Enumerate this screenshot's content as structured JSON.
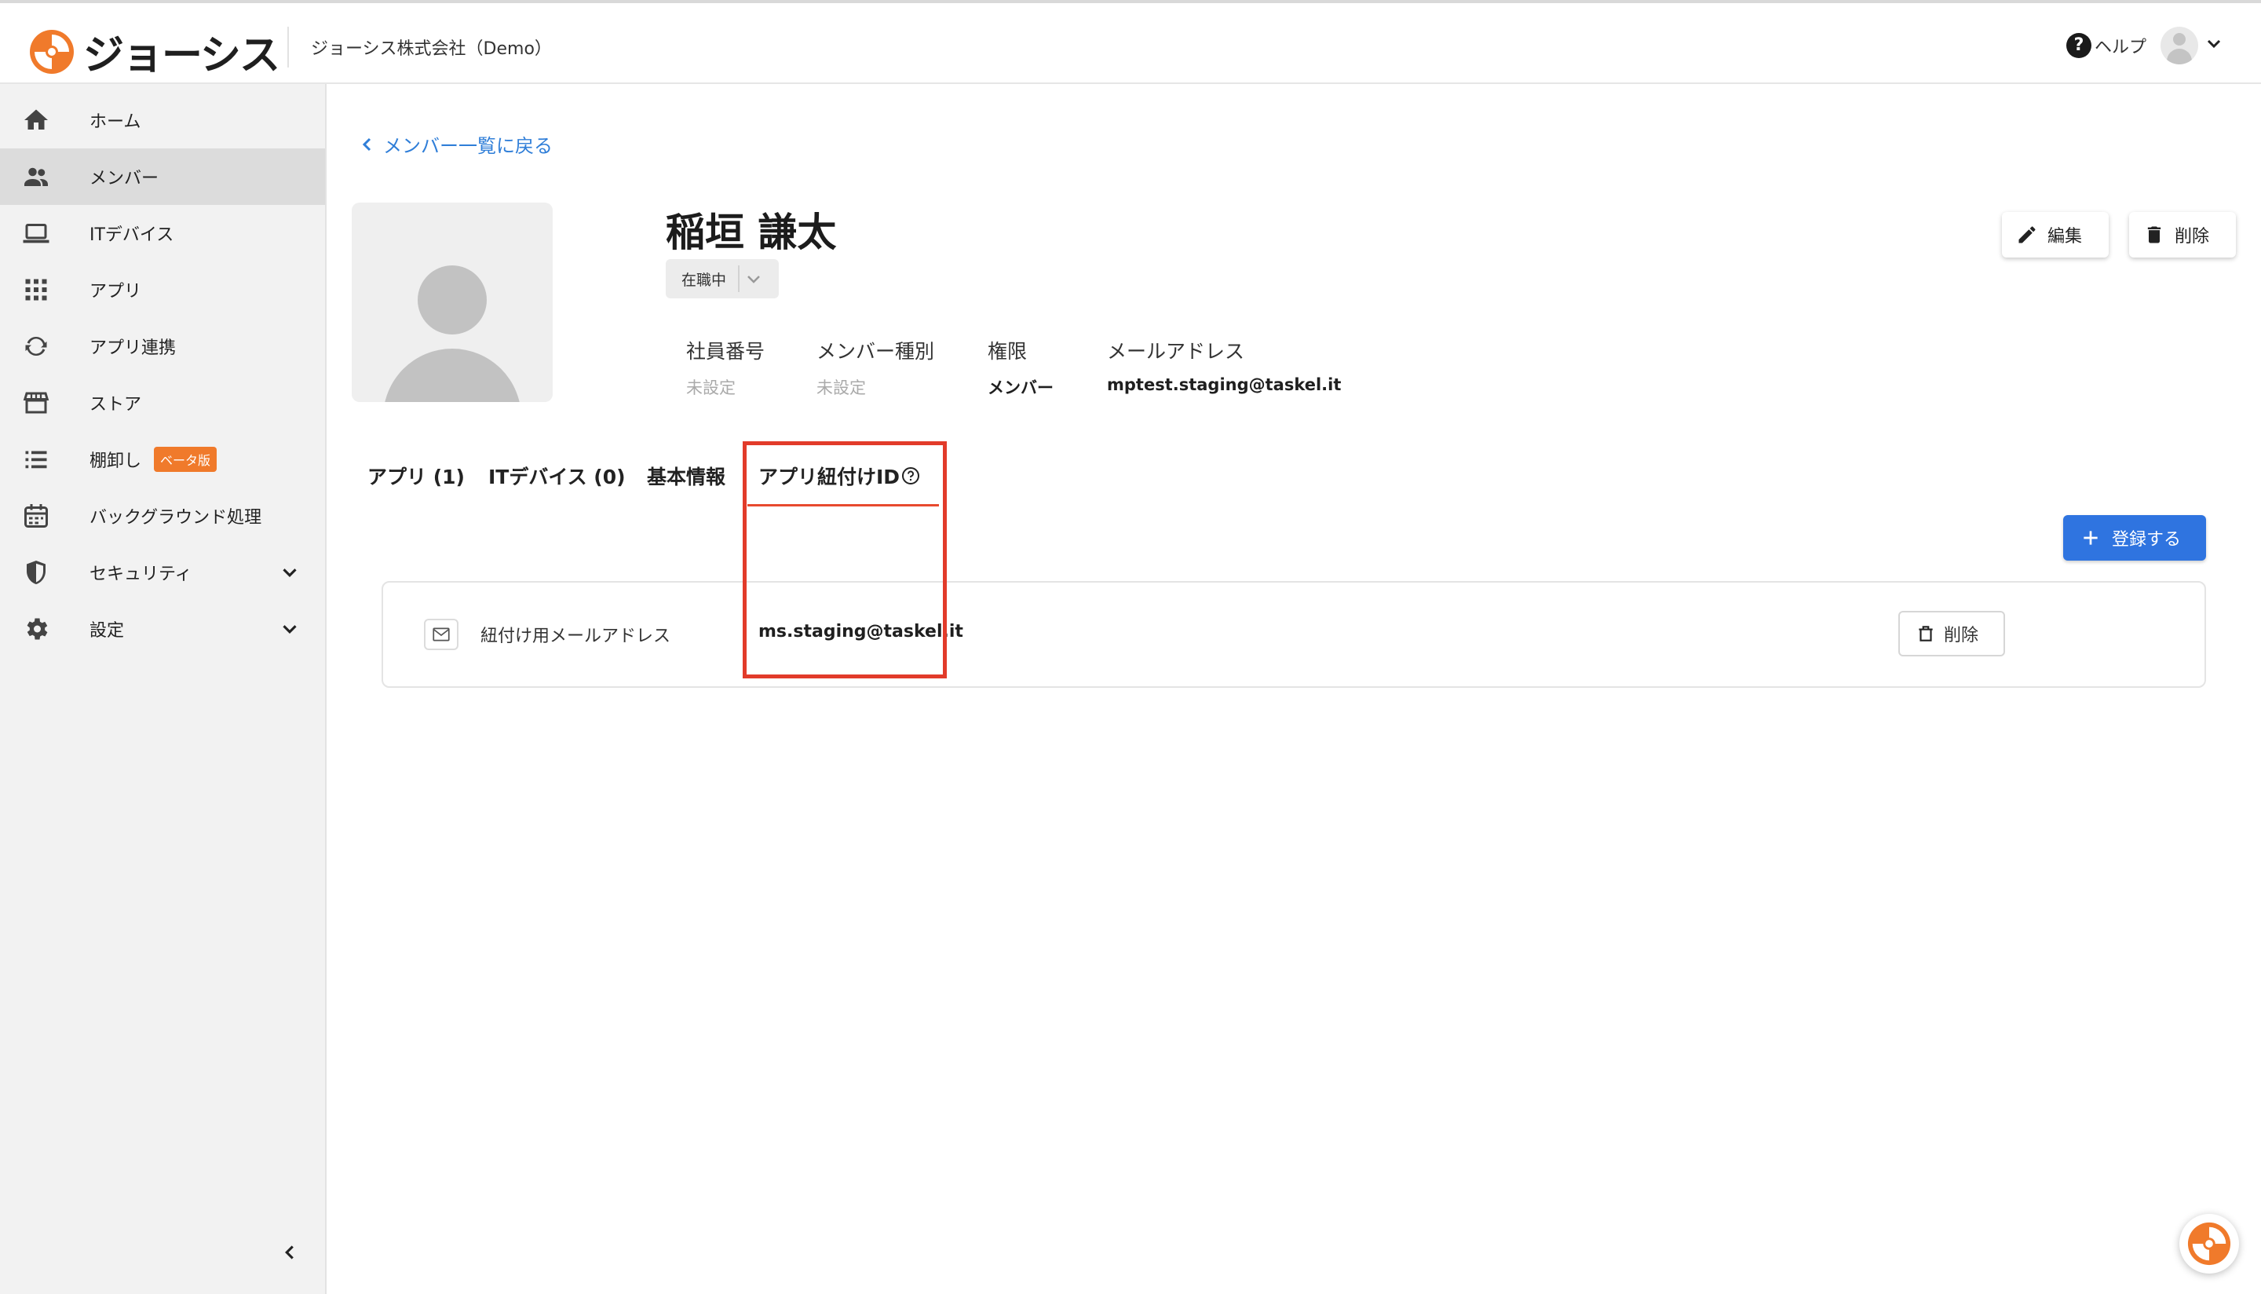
{
  "header": {
    "logo_text": "ジョーシス",
    "company": "ジョーシス株式会社（Demo）",
    "help_label": "ヘルプ",
    "help_icon_glyph": "?",
    "brand_color": "#f07a2b"
  },
  "sidebar": {
    "items": [
      {
        "label": "ホーム",
        "icon": "home-icon"
      },
      {
        "label": "メンバー",
        "icon": "people-icon",
        "active": true
      },
      {
        "label": "ITデバイス",
        "icon": "laptop-icon"
      },
      {
        "label": "アプリ",
        "icon": "grid-icon"
      },
      {
        "label": "アプリ連携",
        "icon": "sync-icon"
      },
      {
        "label": "ストア",
        "icon": "store-icon"
      },
      {
        "label": "棚卸し",
        "icon": "list-icon",
        "badge": "ベータ版"
      },
      {
        "label": "バックグラウンド処理",
        "icon": "calendar-icon"
      },
      {
        "label": "セキュリティ",
        "icon": "shield-icon",
        "expandable": true
      },
      {
        "label": "設定",
        "icon": "gear-icon",
        "expandable": true
      }
    ]
  },
  "main": {
    "back_link": "メンバー一覧に戻る",
    "member_name": "稲垣 謙太",
    "status": "在職中",
    "edit_label": "編集",
    "delete_label": "削除",
    "fields": [
      {
        "label": "社員番号",
        "value": "未設定",
        "muted": true
      },
      {
        "label": "メンバー種別",
        "value": "未設定",
        "muted": true
      },
      {
        "label": "権限",
        "value": "メンバー",
        "muted": false
      },
      {
        "label": "メールアドレス",
        "value": "mptest.staging@taskel.it",
        "muted": false
      }
    ],
    "tabs": [
      {
        "label": "アプリ (1)"
      },
      {
        "label": "ITデバイス (0)"
      },
      {
        "label": "基本情報"
      },
      {
        "label": "アプリ紐付けID",
        "active": true
      }
    ],
    "register_label": "登録する",
    "link_id_rows": [
      {
        "label": "紐付け用メールアドレス",
        "value": "ms.staging@taskel.it",
        "delete_label": "削除"
      }
    ],
    "accent_color": "#2f74e0",
    "highlight_color": "#e23b2a"
  }
}
